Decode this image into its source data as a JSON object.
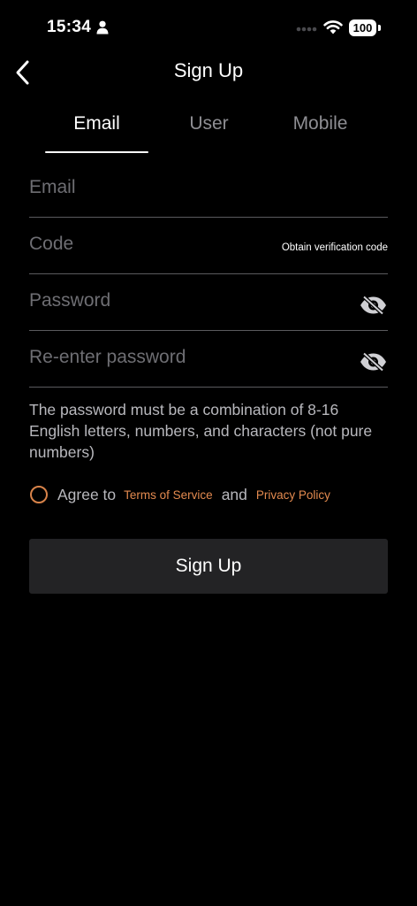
{
  "status_bar": {
    "time": "15:34",
    "battery": "100"
  },
  "header": {
    "title": "Sign Up"
  },
  "tabs": [
    {
      "label": "Email",
      "active": true
    },
    {
      "label": "User",
      "active": false
    },
    {
      "label": "Mobile",
      "active": false
    }
  ],
  "form": {
    "email": {
      "placeholder": "Email",
      "value": ""
    },
    "code": {
      "placeholder": "Code",
      "value": "",
      "action_label": "Obtain verification code"
    },
    "password": {
      "placeholder": "Password",
      "value": ""
    },
    "repassword": {
      "placeholder": "Re-enter password",
      "value": ""
    },
    "hint": "The password must be a combination of 8-16 English letters, numbers, and characters (not pure numbers)"
  },
  "agreement": {
    "prefix": "Agree to",
    "terms_label": "Terms of Service",
    "and": "and",
    "privacy_label": "Privacy Policy",
    "checked": false
  },
  "submit": {
    "label": "Sign Up"
  },
  "colors": {
    "accent": "#e38a4f",
    "button_bg": "#232325",
    "background": "#000000"
  }
}
